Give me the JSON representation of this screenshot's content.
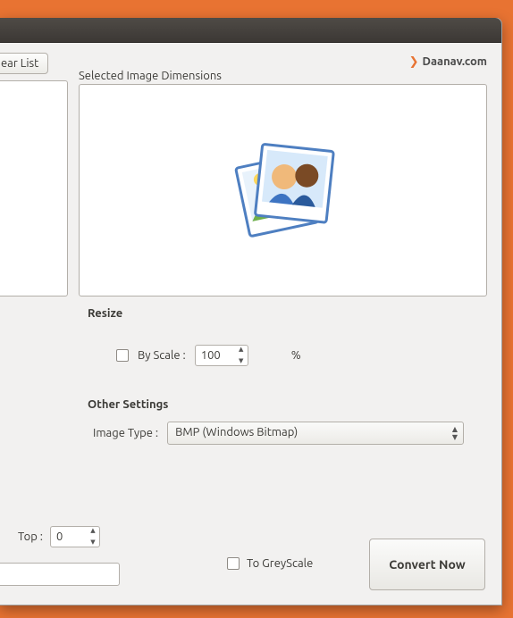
{
  "buttons": {
    "clear_list": "ear List",
    "convert": "Convert Now"
  },
  "branding": {
    "label": "Daanav.com"
  },
  "sections": {
    "dimensions": "Selected Image Dimensions",
    "resize": "Resize",
    "other": "Other Settings"
  },
  "resize": {
    "by_scale_label": "By Scale :",
    "scale_value": "100",
    "percent": "%"
  },
  "image_type": {
    "label": "Image Type :",
    "selected": "BMP (Windows Bitmap)"
  },
  "crop": {
    "top_label": "Top :",
    "top_value": "0"
  },
  "greyscale": {
    "label": "To GreyScale"
  }
}
